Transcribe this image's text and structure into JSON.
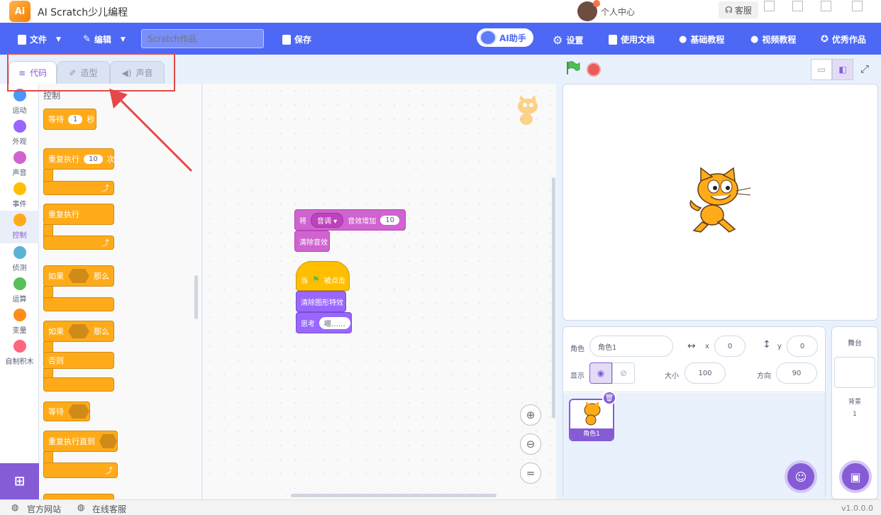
{
  "app": {
    "title": "AI Scratch少儿编程",
    "logo_text": "Ai"
  },
  "titlebar": {
    "personal_center": "个人中心",
    "service": "客服"
  },
  "menubar": {
    "file": "文件",
    "edit": "编辑",
    "project_placeholder": "Scratch作品",
    "save": "保存",
    "ai_assistant": "AI助手",
    "settings": "设置",
    "docs": "使用文档",
    "basic_tutorial": "基础教程",
    "video_tutorial": "视频教程",
    "excellent_works": "优秀作品"
  },
  "tabs": [
    {
      "label": "代码",
      "active": true
    },
    {
      "label": "造型",
      "active": false
    },
    {
      "label": "声音",
      "active": false
    }
  ],
  "categories": [
    {
      "label": "运动",
      "color": "#4c97ff"
    },
    {
      "label": "外观",
      "color": "#9966ff"
    },
    {
      "label": "声音",
      "color": "#cf63cf"
    },
    {
      "label": "事件",
      "color": "#ffbf00"
    },
    {
      "label": "控制",
      "color": "#ffab19",
      "active": true
    },
    {
      "label": "侦测",
      "color": "#5cb1d6"
    },
    {
      "label": "运算",
      "color": "#59c059"
    },
    {
      "label": "变量",
      "color": "#ff8c1a"
    },
    {
      "label": "自制积木",
      "color": "#ff6680"
    }
  ],
  "palette": {
    "title": "控制",
    "wait": {
      "label": "等待",
      "value": "1",
      "unit": "秒"
    },
    "repeat": {
      "label": "重复执行",
      "value": "10",
      "unit": "次"
    },
    "forever": {
      "label": "重复执行"
    },
    "if_then": {
      "label": "如果",
      "then": "那么"
    },
    "if_else": {
      "label": "如果",
      "then": "那么",
      "else": "否则"
    },
    "wait_until": {
      "label": "等待"
    },
    "repeat_until": {
      "label": "重复执行直到"
    }
  },
  "workspace": {
    "sound_effect": {
      "prefix": "将",
      "dropdown": "音调",
      "suffix": "音效增加",
      "value": "10"
    },
    "clear_sound": "清除音效",
    "when_flag": {
      "prefix": "当",
      "suffix": "被点击"
    },
    "clear_graphic": "清除图形特效",
    "think": {
      "label": "思考",
      "value": "嗯……"
    }
  },
  "sprite_info": {
    "sprite_label": "角色",
    "sprite_name": "角色1",
    "x_label": "x",
    "x_value": "0",
    "y_label": "y",
    "y_value": "0",
    "show_label": "显示",
    "size_label": "大小",
    "size_value": "100",
    "direction_label": "方向",
    "direction_value": "90"
  },
  "sprite_list": [
    {
      "name": "角色1"
    }
  ],
  "stage_panel": {
    "title": "舞台",
    "backdrop_label": "背景",
    "backdrop_count": "1"
  },
  "bottombar": {
    "official_site": "官方网站",
    "online_service": "在线客服",
    "version": "v1.0.0.0"
  },
  "colors": {
    "accent": "#855cd6",
    "menubar": "#4d68f5",
    "control": "#ffab19",
    "highlight": "#e54848"
  }
}
